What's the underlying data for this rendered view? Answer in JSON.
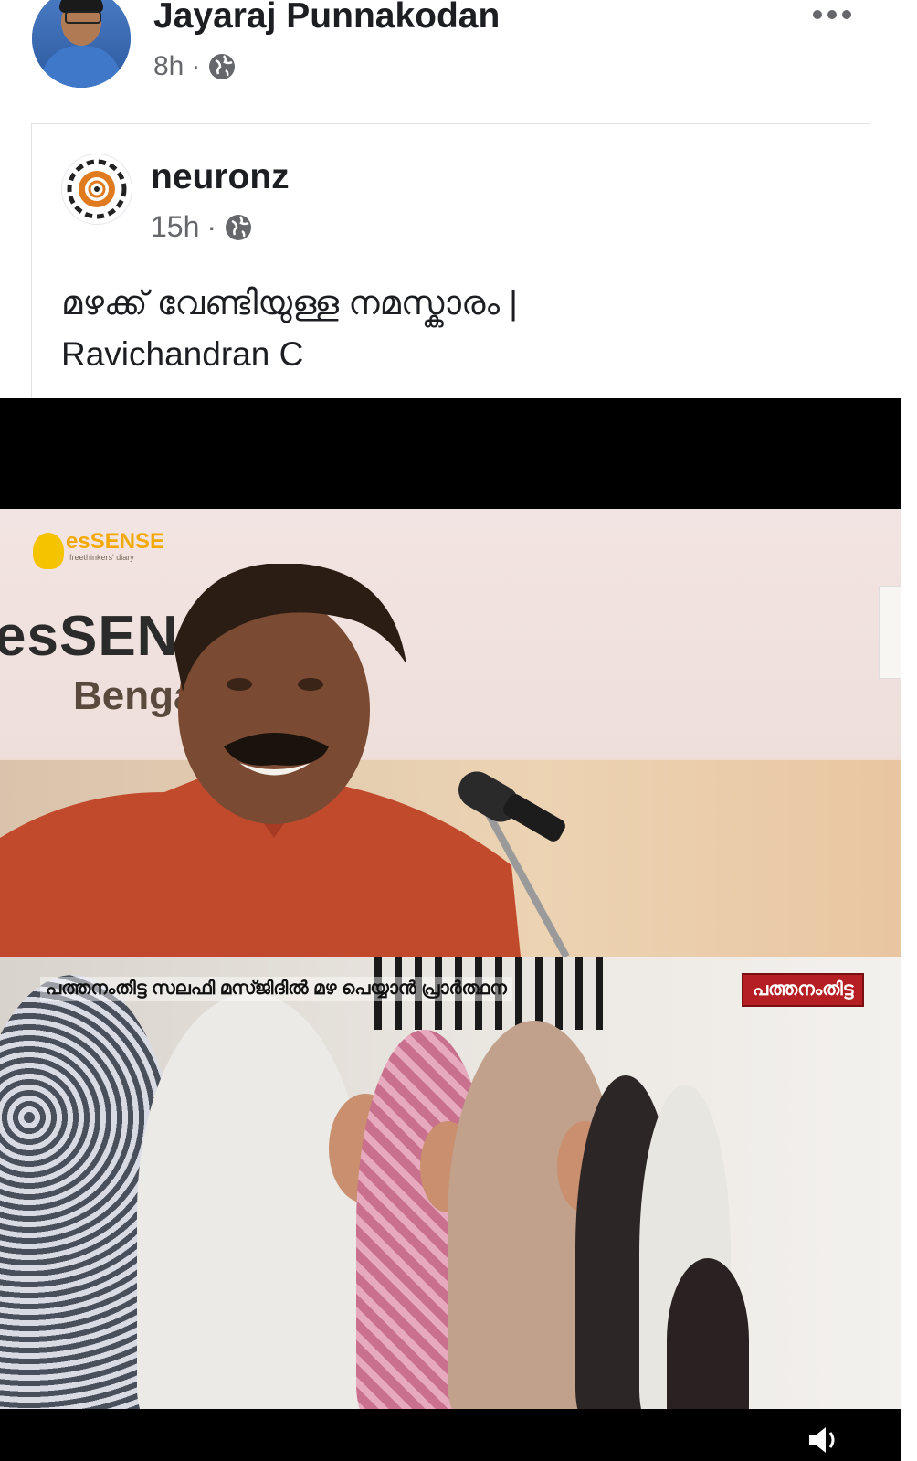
{
  "post": {
    "author_name": "Jayaraj Punnakodan",
    "time": "8h",
    "separator": "·",
    "privacy_icon": "globe-icon",
    "more_icon": "more-options-icon"
  },
  "shared": {
    "page_name": "neuronz",
    "time": "15h",
    "separator": "·",
    "privacy_icon": "globe-icon",
    "text_line1": "മഴക്ക് വേണ്ടിയുള്ള നമസ്കാരം |",
    "text_line2": "Ravichandran C"
  },
  "video": {
    "logo_brand": "esSENSE",
    "logo_tagline": "freethinkers' diary",
    "banner_line1": "esSEN",
    "banner_line2": "Benga",
    "ticker_text": "പത്തനംതിട്ട സലഫി മസ്ജിദിൽ മഴ പെയ്യാൻ പ്രാർത്ഥന",
    "location_badge": "പത്തനംതിട്ട",
    "volume_icon": "volume-icon"
  },
  "colors": {
    "text_primary": "#1c1e21",
    "text_secondary": "#65676b",
    "badge_red": "#b51f24"
  }
}
